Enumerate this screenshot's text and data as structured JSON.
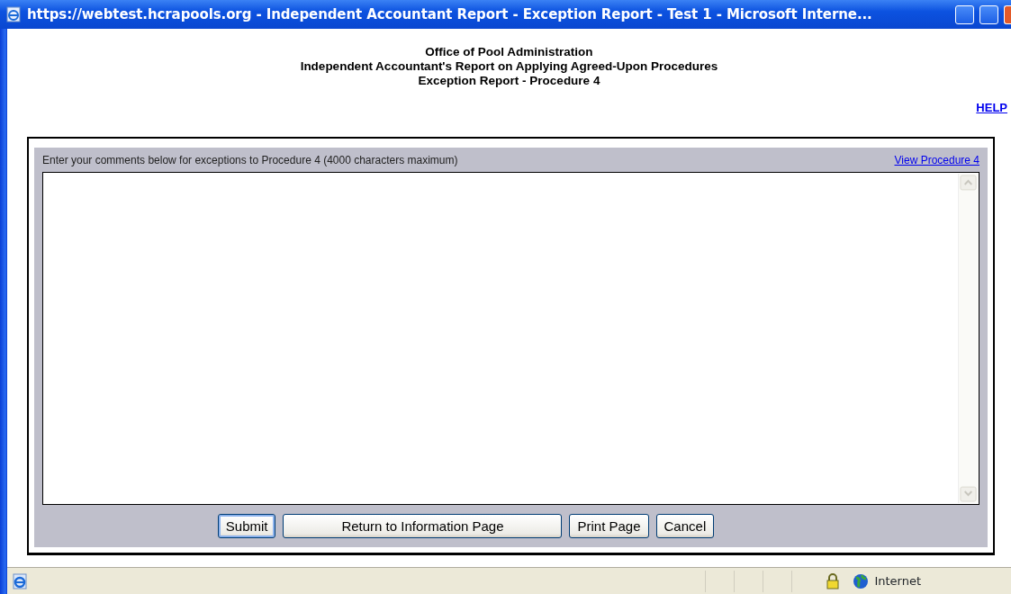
{
  "window": {
    "title": "https://webtest.hcrapools.org - Independent Accountant Report - Exception Report - Test 1 - Microsoft Interne..."
  },
  "header": {
    "lines": [
      "Office of Pool Administration",
      "Independent Accountant's Report on Applying Agreed-Upon Procedures",
      "Exception Report - Procedure 4"
    ]
  },
  "help_link": "HELP",
  "form": {
    "instruction": "Enter your comments below for exceptions to Procedure 4 (4000 characters maximum)",
    "view_link": "View Procedure 4",
    "buttons": [
      {
        "label": "Submit",
        "kind": "default"
      },
      {
        "label": "Return to Information Page",
        "kind": "normal"
      },
      {
        "label": "Print Page",
        "kind": "normal"
      },
      {
        "label": "Cancel",
        "kind": "normal"
      }
    ]
  },
  "status_bar": {
    "zone": "Internet"
  }
}
